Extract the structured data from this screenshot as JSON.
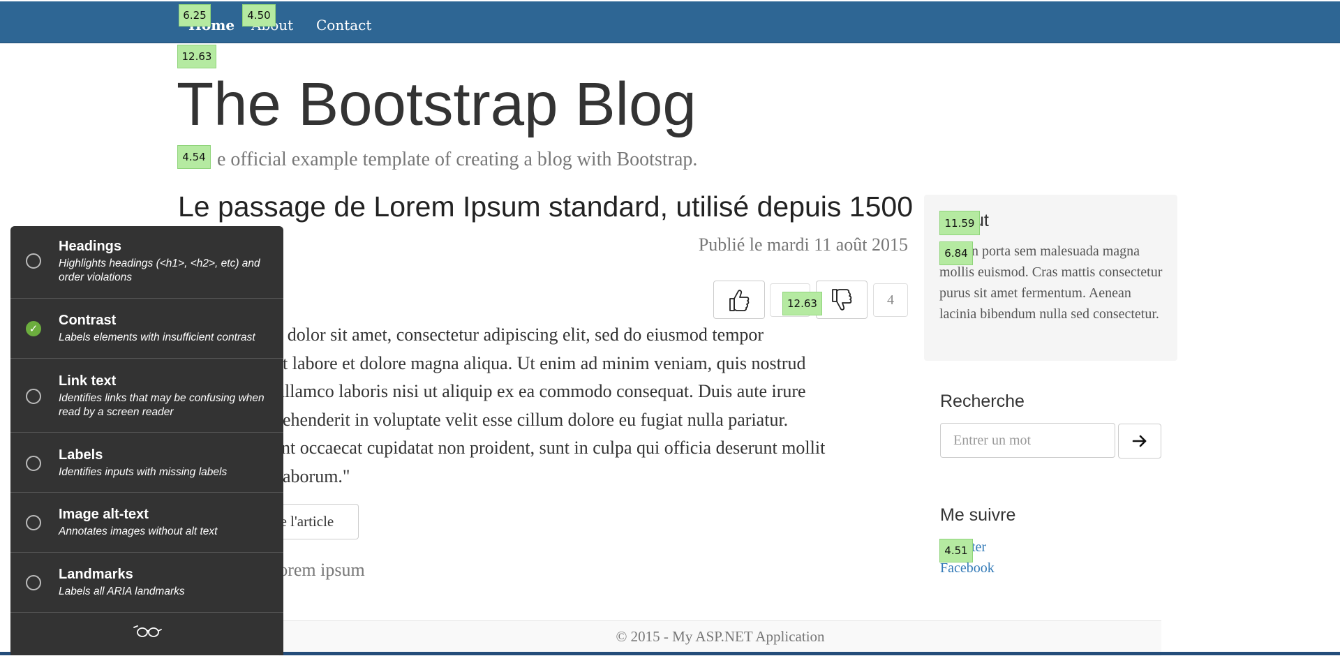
{
  "nav": {
    "links": [
      "Home",
      "About",
      "Contact"
    ],
    "active_index": 0
  },
  "blog": {
    "title": "The Bootstrap Blog",
    "description_visible": "e official example template of creating a blog with Bootstrap."
  },
  "post": {
    "title": "Le passage de Lorem Ipsum standard, utilisé depuis 1500",
    "date": "Publié le mardi 11 août 2015",
    "votes": {
      "like_icon": "thumbs-up-icon",
      "dislike_icon": "thumbs-down-icon",
      "dislike_count": "4"
    },
    "body_lines": [
      "m dolor sit amet, consectetur adipiscing elit, sed do eiusmod tempor",
      "t labore et dolore magna aliqua. Ut enim ad minim veniam, quis nostrud",
      "ullamco laboris nisi ut aliquip ex ea commodo consequat. Duis aute irure",
      "ehenderit in voluptate velit esse cillum dolore eu fugiat nulla pariatur.",
      "nt occaecat cupidatat non proident, sunt in culpa qui officia deserunt mollit",
      "aborum.\""
    ],
    "read_more_label": "le l'article",
    "next_post_label": "lorem ipsum"
  },
  "sidebar": {
    "about_title": "ut",
    "about_text": "n porta sem malesuada magna mollis euismod. Cras mattis consectetur purus sit amet fermentum. Aenean lacinia bibendum nulla sed consectetur.",
    "search_title": "Recherche",
    "search_placeholder": "Entrer un mot",
    "search_icon": "arrow-right-icon",
    "follow_title": "Me suivre",
    "follow_links": [
      "ter",
      "Facebook"
    ]
  },
  "footer": {
    "text": "© 2015 - My ASP.NET Application"
  },
  "contrast_badges": [
    "6.25",
    "4.50",
    "12.63",
    "4.54",
    "12.63",
    "11.59",
    "6.84",
    "4.51"
  ],
  "a11y_panel": {
    "items": [
      {
        "title": "Headings",
        "desc": "Highlights headings (<h1>, <h2>, etc) and order violations",
        "checked": false
      },
      {
        "title": "Contrast",
        "desc": "Labels elements with insufficient contrast",
        "checked": true
      },
      {
        "title": "Link text",
        "desc": "Identifies links that may be confusing when read by a screen reader",
        "checked": false
      },
      {
        "title": "Labels",
        "desc": "Identifies inputs with missing labels",
        "checked": false
      },
      {
        "title": "Image alt-text",
        "desc": "Annotates images without alt text",
        "checked": false
      },
      {
        "title": "Landmarks",
        "desc": "Labels all ARIA landmarks",
        "checked": false
      }
    ],
    "footer_icon": "glasses-icon",
    "check_glyph": "✓"
  },
  "colors": {
    "navbar": "#2e6694",
    "link": "#337ab7",
    "panel": "#333333",
    "badge": "#b5eaa1",
    "check": "#6cae3e"
  }
}
